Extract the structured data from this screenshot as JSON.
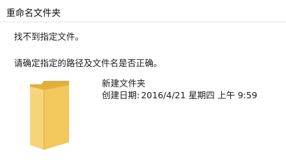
{
  "window": {
    "title": "重命名文件夹"
  },
  "message": {
    "line1": "找不到指定文件。",
    "line2": "请确定指定的路径及文件名是否正确。"
  },
  "item": {
    "icon": "folder-icon",
    "name": "新建文件夹",
    "date_label": "创建日期:",
    "date_value": "2016/4/21 星期四 上午 9:59"
  },
  "colors": {
    "folder_front": "#f2c75c",
    "folder_back": "#e3ae3c",
    "separator": "#e6e6e6"
  }
}
